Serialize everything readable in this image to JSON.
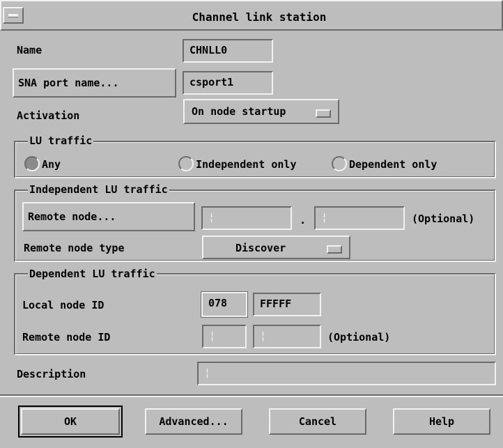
{
  "window": {
    "title": "Channel link station"
  },
  "name": {
    "label": "Name",
    "value": "CHNLL0"
  },
  "sna_port": {
    "button_label": "SNA port name...",
    "value": "csport1"
  },
  "activation": {
    "label": "Activation",
    "value": "On node startup"
  },
  "lu_traffic": {
    "legend": "LU traffic",
    "options": [
      "Any",
      "Independent only",
      "Dependent only"
    ],
    "selected": "Any"
  },
  "independent_lu": {
    "legend": "Independent LU traffic",
    "remote_node_button": "Remote node...",
    "remote_node_value_1": "",
    "separator": ".",
    "remote_node_value_2": "",
    "optional_note": "(Optional)",
    "remote_node_type_label": "Remote node type",
    "remote_node_type_value": "Discover"
  },
  "dependent_lu": {
    "legend": "Dependent LU traffic",
    "local_node_id_label": "Local node ID",
    "local_node_id_block": "078",
    "local_node_id_num": "FFFFF",
    "remote_node_id_label": "Remote node ID",
    "remote_node_id_block": "",
    "remote_node_id_num": "",
    "optional_note": "(Optional)"
  },
  "description": {
    "label": "Description",
    "value": ""
  },
  "buttons": {
    "ok": "OK",
    "advanced": "Advanced...",
    "cancel": "Cancel",
    "help": "Help"
  },
  "colors": {
    "face": "#bdbdbd",
    "highlight": "#f2f2f2",
    "shadow": "#6b6b6b"
  }
}
